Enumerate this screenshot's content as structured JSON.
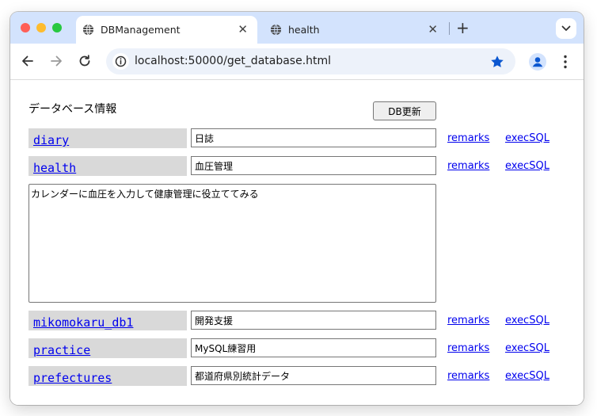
{
  "browser": {
    "tabs": [
      {
        "title": "DBManagement",
        "active": true
      },
      {
        "title": "health",
        "active": false
      }
    ],
    "tab_close_glyph": "✕",
    "new_tab_glyph": "+",
    "url": "localhost:50000/get_database.html",
    "accent_color": "#0b57d0",
    "tabstrip_color": "#d3e3fd"
  },
  "page": {
    "heading": "データベース情報",
    "update_button": "DB更新",
    "databases": [
      {
        "name": "diary",
        "description": "日誌",
        "remarks_link": "remarks",
        "exec_link": "execSQL"
      },
      {
        "name": "health",
        "description": "血圧管理",
        "remarks_link": "remarks",
        "exec_link": "execSQL"
      },
      {
        "name": "mikomokaru_db1",
        "description": "開発支援",
        "remarks_link": "remarks",
        "exec_link": "execSQL"
      },
      {
        "name": "practice",
        "description": "MySQL練習用",
        "remarks_link": "remarks",
        "exec_link": "execSQL"
      },
      {
        "name": "prefectures",
        "description": "都道府県別統計データ",
        "remarks_link": "remarks",
        "exec_link": "execSQL"
      }
    ],
    "remarks_text": "カレンダーに血圧を入力して健康管理に役立ててみる"
  }
}
